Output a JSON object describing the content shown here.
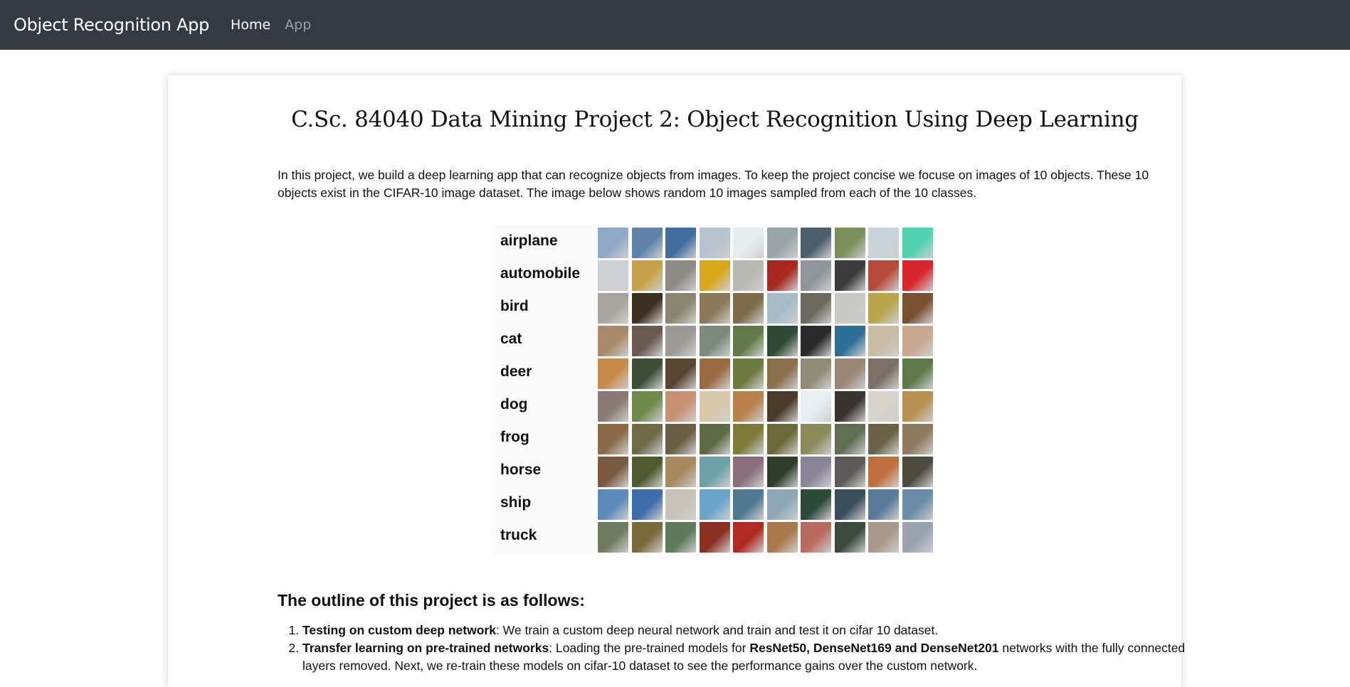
{
  "navbar": {
    "brand": "Object Recognition App",
    "links": [
      {
        "label": "Home",
        "active": true
      },
      {
        "label": "App",
        "active": false
      }
    ]
  },
  "main": {
    "title": "C.Sc. 84040 Data Mining Project 2: Object Recognition Using Deep Learning",
    "intro": "In this project, we build a deep learning app that can recognize objects from images. To keep the project concise we focuse on images of 10 objects. These 10 objects exist in the CIFAR-10 image dataset. The image below shows random 10 images sampled from each of the 10 classes.",
    "sample_grid": {
      "classes": [
        "airplane",
        "automobile",
        "bird",
        "cat",
        "deer",
        "dog",
        "frog",
        "horse",
        "ship",
        "truck"
      ],
      "class_colors": [
        [
          "#8fa8c6",
          "#5f80a8",
          "#3f6d9e",
          "#b5c4cf",
          "#e6eef0",
          "#9aa4a8",
          "#4a5e6e",
          "#7c8f5a",
          "#c9d3d9",
          "#4fd3b0"
        ],
        [
          "#cfd2d5",
          "#c7a24a",
          "#8e8a86",
          "#d8a81c",
          "#b9b9b4",
          "#a8281f",
          "#8e949a",
          "#3c3a3c",
          "#b84a3c",
          "#d8262a"
        ],
        [
          "#a6a49c",
          "#3c3020",
          "#8a8670",
          "#8a7856",
          "#7f6a4a",
          "#a8bcc8",
          "#6c6a60",
          "#c8c8c4",
          "#b8a44a",
          "#7a5030"
        ],
        [
          "#a88a6a",
          "#6a5a50",
          "#9c9a94",
          "#7a8a7c",
          "#5f7a48",
          "#2f4a36",
          "#2a2a2a",
          "#2d6e96",
          "#c8bca4",
          "#c8a890"
        ],
        [
          "#c88a4a",
          "#3c4e36",
          "#5a4430",
          "#9a6a40",
          "#6c7a3e",
          "#8a6e4a",
          "#8e8a74",
          "#9c8474",
          "#7a7068",
          "#5e7a4a"
        ],
        [
          "#8a7c74",
          "#6e8a4a",
          "#c89070",
          "#d8c8a8",
          "#b8804a",
          "#4a3a2a",
          "#e8eef4",
          "#3a3430",
          "#d8d4cc",
          "#b89050"
        ],
        [
          "#8a6a48",
          "#6e6a46",
          "#6a5e44",
          "#5e6a44",
          "#7e7a38",
          "#6a6a3a",
          "#8a8a5a",
          "#5e6e52",
          "#6a6248",
          "#8e7a5e"
        ],
        [
          "#7a5a40",
          "#4e5a2e",
          "#a88a5e",
          "#6aa0a8",
          "#8a6e7c",
          "#2e3e2a",
          "#8a8498",
          "#5e5a58",
          "#c0703c",
          "#4e4a40"
        ],
        [
          "#5a8ab8",
          "#3a6aa8",
          "#c8c4b8",
          "#6aa4c8",
          "#4e7890",
          "#8ea8b8",
          "#2c4a3a",
          "#3a4e5a",
          "#5a7a98",
          "#6a8ea8"
        ],
        [
          "#6e7a5e",
          "#7a6a3c",
          "#5a7a5a",
          "#8a2e20",
          "#b02a20",
          "#a8784a",
          "#b86a5e",
          "#3a4a3e",
          "#a8988c",
          "#9ca4b0"
        ]
      ]
    },
    "outline": {
      "heading": "The outline of this project is as follows:",
      "items": [
        {
          "bold": "Testing on custom deep network",
          "text": ": We train a custom deep neural network and train and test it on cifar 10 dataset."
        },
        {
          "bold": "Transfer learning on pre-trained networks",
          "text": ": Loading the pre-trained models for ",
          "bold2": "ResNet50, DenseNet169 and DenseNet201",
          "text2": " networks with the fully connected layers removed. Next, we re-train these models on cifar-10 dataset to see the performance gains over the custom network."
        }
      ]
    }
  }
}
